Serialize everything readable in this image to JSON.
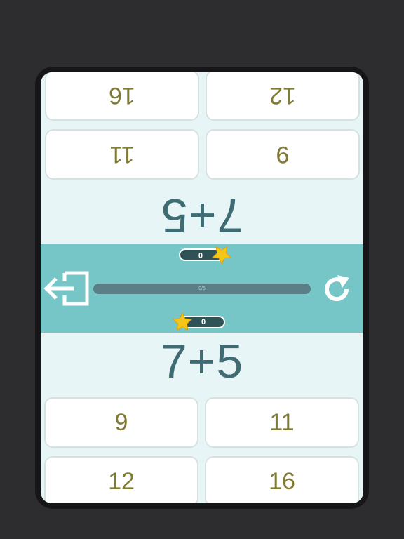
{
  "player_top": {
    "question": "7+5",
    "score": "0",
    "answers": [
      "9",
      "11",
      "12",
      "16"
    ]
  },
  "player_bottom": {
    "question": "7+5",
    "score": "0",
    "answers": [
      "9",
      "11",
      "12",
      "16"
    ]
  },
  "center": {
    "progress_label": "0/6",
    "progress_fraction": 0.0,
    "exit_icon": "exit-icon",
    "restart_icon": "restart-icon"
  },
  "colors": {
    "background": "#e8f5f6",
    "panel": "#76c6c8",
    "question_text": "#3f6b73",
    "answer_text": "#7f7a34",
    "star": "#f5c518"
  }
}
